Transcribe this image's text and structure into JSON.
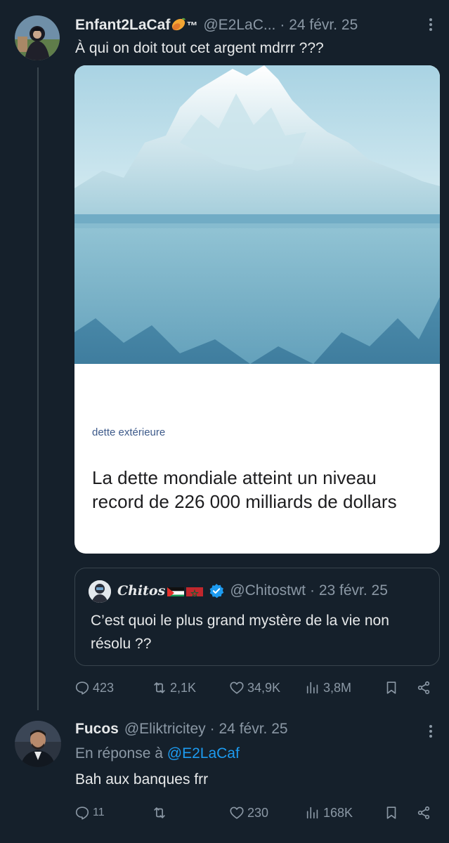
{
  "main_tweet": {
    "author_name": "Enfant2LaCaf",
    "author_suffix": "™",
    "handle": "@E2LaC...",
    "date": "· 24 févr. 25",
    "text": "À qui on doit tout cet argent mdrrr ???",
    "media": {
      "category": "dette extérieure",
      "headline": "La dette mondiale atteint un niveau record de 226 000 milliards de dollars"
    },
    "quoted_tweet": {
      "author_name": "Chitos",
      "handle": "@Chitostwt",
      "date": "· 23 févr. 25",
      "text": "C’est quoi le plus grand mystère de la vie non résolu ??"
    },
    "stats": {
      "replies": "423",
      "retweets": "2,1K",
      "likes": "34,9K",
      "views": "3,8M"
    }
  },
  "reply_tweet": {
    "author_name": "Fucos",
    "handle": "@Eliktricitey",
    "date": "· 24 févr. 25",
    "reply_prefix": "En réponse à",
    "reply_handle": "@E2LaCaf",
    "text": "Bah aux banques frr",
    "stats": {
      "replies": "11",
      "retweets": "",
      "likes": "230",
      "views": "168K"
    }
  },
  "colors": {
    "background": "#15202b",
    "text": "#e7e9ea",
    "muted": "#8b98a5",
    "accent": "#1d9bf0",
    "border": "#38444d"
  }
}
